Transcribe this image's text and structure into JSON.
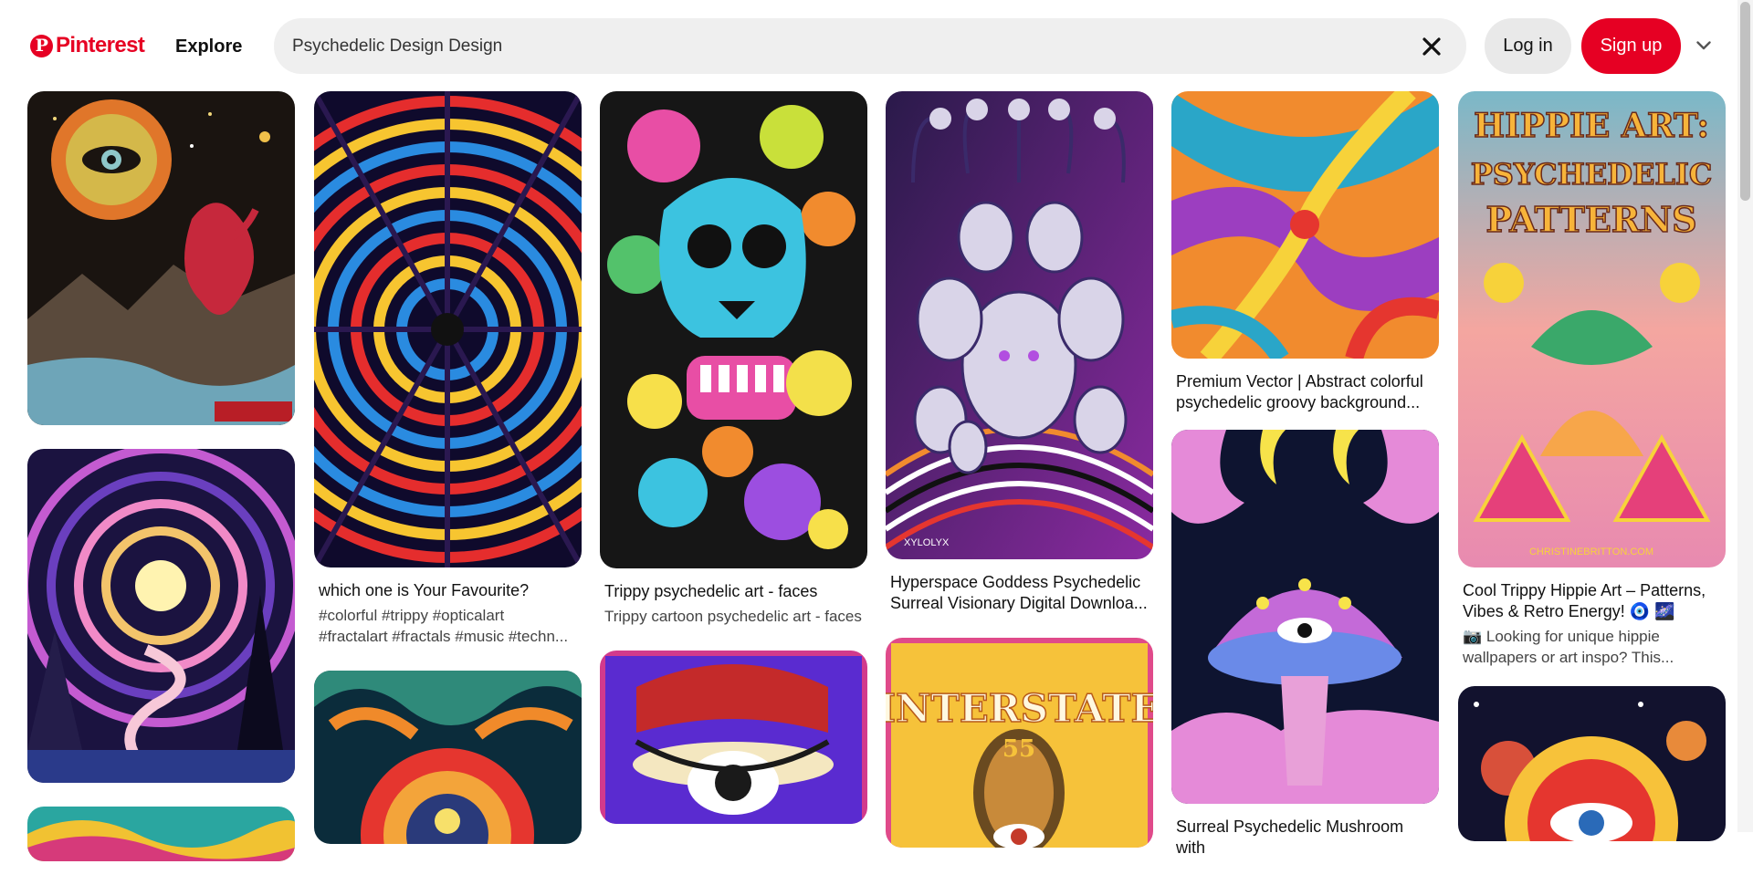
{
  "header": {
    "logo_mark": "P",
    "logo_text": "Pinterest",
    "explore_label": "Explore",
    "search_value": "Psychedelic Design Design",
    "clear_icon": "close-icon",
    "login_label": "Log in",
    "signup_label": "Sign up",
    "menu_icon": "chevron-down-icon"
  },
  "colors": {
    "brand_red": "#e60023",
    "search_bg": "#efefef",
    "login_bg": "#e9e9e9"
  },
  "pins": {
    "c2p1": {
      "title": "which one is Your Favourite?",
      "desc": "#colorful #trippy #opticalart #fractalart #fractals #music #techn..."
    },
    "c3p1": {
      "title": "Trippy psychedelic art - faces",
      "desc": "Trippy cartoon psychedelic art - faces"
    },
    "c4p1": {
      "title": "Hyperspace Goddess Psychedelic Surreal Visionary Digital Downloa...",
      "watermark": "XYLOLYX"
    },
    "c4p2": {
      "poster_text": "INTERSTATE",
      "poster_num": "55"
    },
    "c5p1": {
      "title": "Premium Vector | Abstract colorful psychedelic groovy background..."
    },
    "c5p2": {
      "title": "Surreal Psychedelic Mushroom with"
    },
    "c6p1": {
      "poster_line1": "HIPPIE ART:",
      "poster_line2": "PSYCHEDELIC",
      "poster_line3": "PATTERNS",
      "poster_site": "CHRISTINEBRITTON.COM",
      "title": "Cool Trippy Hippie Art – Patterns, Vibes & Retro Energy! 🧿 🌌",
      "desc": "📷 Looking for unique hippie wallpapers or art inspo? This..."
    }
  }
}
